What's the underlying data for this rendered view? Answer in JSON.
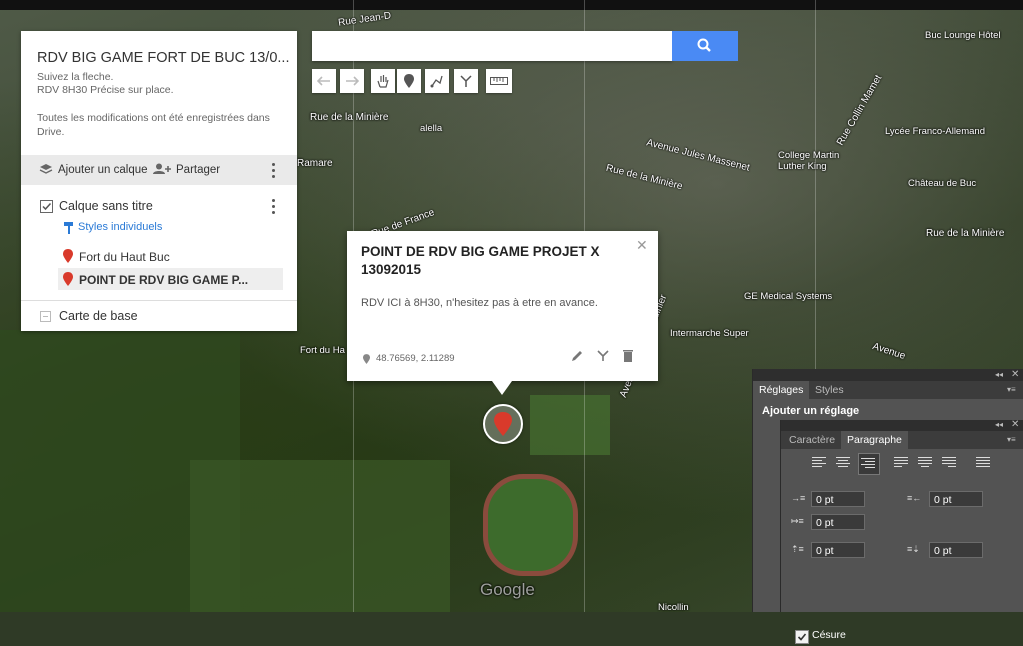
{
  "map": {
    "roads": [
      {
        "label": "Rue Jean-D"
      },
      {
        "label": "Rue de la Minière"
      },
      {
        "label": "Avenue Jules Massenet"
      },
      {
        "label": "Rue de la Minière"
      },
      {
        "label": "Rue de la Minière"
      },
      {
        "label": "Avenue Morane Saulnier"
      },
      {
        "label": "Avenue"
      },
      {
        "label": "Rue Collin Mamet"
      },
      {
        "label": "Rue de France"
      },
      {
        "label": "Ramare"
      }
    ],
    "pois": [
      {
        "label": "alella"
      },
      {
        "label": "Buc Lounge Hôtel"
      },
      {
        "label": "Lycée Franco-Allemand"
      },
      {
        "label": "College Martin Luther King"
      },
      {
        "label": "Château de Buc"
      },
      {
        "label": "GE Medical Systems"
      },
      {
        "label": "Intermarche Super"
      },
      {
        "label": "Fort du Ha"
      },
      {
        "label": "Nicollin"
      }
    ],
    "watermark": "Google"
  },
  "panel": {
    "title": "RDV BIG GAME FORT DE BUC 13/0...",
    "description_line1": "Suivez la fleche.",
    "description_line2": "RDV 8H30 Précise sur place.",
    "save_status": "Toutes les modifications ont été enregistrées dans Drive.",
    "add_layer": "Ajouter un calque",
    "share": "Partager",
    "layer_name": "Calque sans titre",
    "styles_link": "Styles individuels",
    "points": [
      {
        "label": "Fort du Haut Buc"
      },
      {
        "label": "POINT DE RDV BIG GAME P..."
      }
    ],
    "basemap": "Carte de base"
  },
  "search": {
    "placeholder": ""
  },
  "toolbar": {
    "icons": [
      "undo-icon",
      "redo-icon",
      "hand-icon",
      "marker-icon",
      "draw-line-icon",
      "directions-icon",
      "ruler-icon"
    ]
  },
  "popup": {
    "title": "POINT DE RDV BIG GAME PROJET X 13092015",
    "description": "RDV ICI à 8H30, n'hesitez pas à etre en avance.",
    "coordinates": "48.76569, 2.11289"
  },
  "ps_panel": {
    "tab_reglages": "Réglages",
    "tab_styles": "Styles",
    "add_adjustment": "Ajouter un réglage",
    "tab_caractere": "Caractère",
    "tab_paragraphe": "Paragraphe",
    "indent_left": "0 pt",
    "indent_right": "0 pt",
    "indent_first": "0 pt",
    "space_before": "0 pt",
    "space_after": "0 pt",
    "hyphenation": "Césure"
  },
  "colors": {
    "accent": "#4a8af4",
    "pin_red": "#d93a2b",
    "link_blue": "#2a7ad6"
  }
}
